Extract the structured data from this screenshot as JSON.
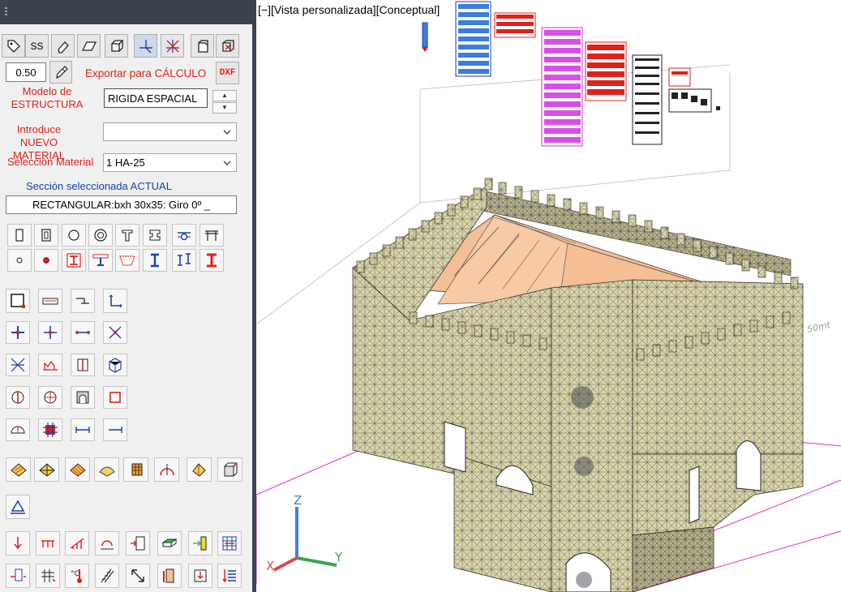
{
  "toolbar_top": {
    "ss_label": "SS"
  },
  "thickness": {
    "value": "0.50"
  },
  "export": {
    "label": "Exportar para  CÁLCULO",
    "dxf_label": "DXF"
  },
  "structure_model": {
    "label": "Modelo de ESTRUCTURA",
    "value": "RIGIDA ESPACIAL"
  },
  "new_material": {
    "label": "Introduce NUEVO MATERIAL",
    "value": ""
  },
  "material_select": {
    "label": "Selección Material",
    "value": "1 HA-25"
  },
  "section": {
    "label": "Sección seleccionada ACTUAL",
    "value": "RECTANGULAR:bxh 30x35: Giro 0º _"
  },
  "viewport": {
    "title": "[−][Vista personalizada][Conceptual]",
    "axis_x": "X",
    "axis_y": "Y",
    "axis_z": "Z",
    "scale_text": "50mt"
  },
  "colors": {
    "panel_bg": "#f0f0f0",
    "dark_bar": "#3b4250",
    "label_red": "#e0201b",
    "label_blue": "#1a3fa8",
    "mesh_fill": "#d9d4a6",
    "roof": "#f5bf95",
    "grid_magenta": "#e040c8"
  }
}
